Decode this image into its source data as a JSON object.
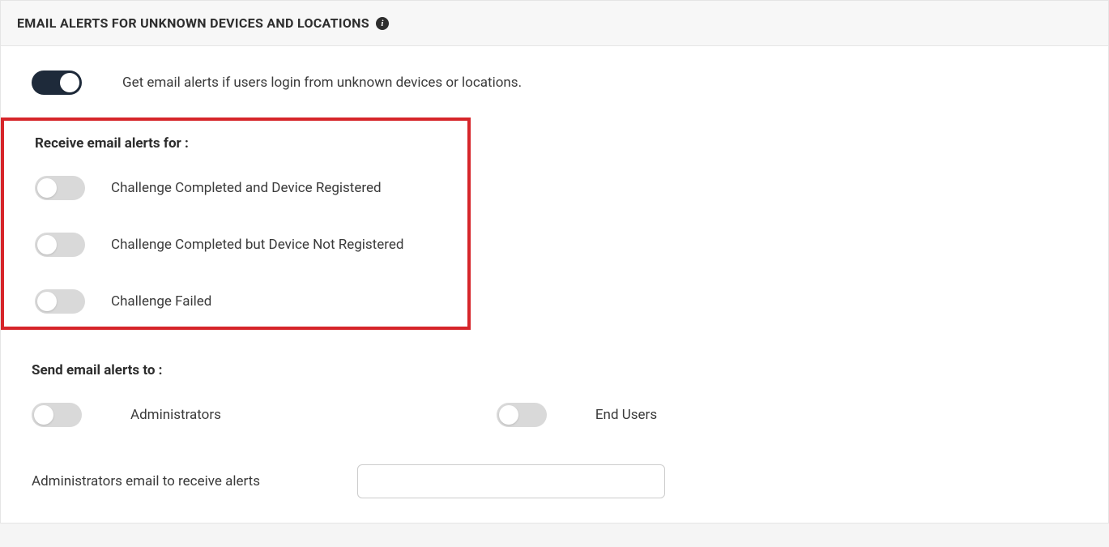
{
  "header": {
    "title": "EMAIL ALERTS FOR UNKNOWN DEVICES AND LOCATIONS"
  },
  "mainToggle": {
    "label": "Get email alerts if users login from unknown devices or locations.",
    "on": true
  },
  "receiveSection": {
    "title": "Receive email alerts for :",
    "options": [
      {
        "label": "Challenge Completed and Device Registered",
        "on": false
      },
      {
        "label": "Challenge Completed but Device Not Registered",
        "on": false
      },
      {
        "label": "Challenge Failed",
        "on": false
      }
    ]
  },
  "sendSection": {
    "title": "Send email alerts to :",
    "options": [
      {
        "label": "Administrators",
        "on": false
      },
      {
        "label": "End Users",
        "on": false
      }
    ]
  },
  "adminEmail": {
    "label": "Administrators email to receive alerts",
    "value": ""
  }
}
